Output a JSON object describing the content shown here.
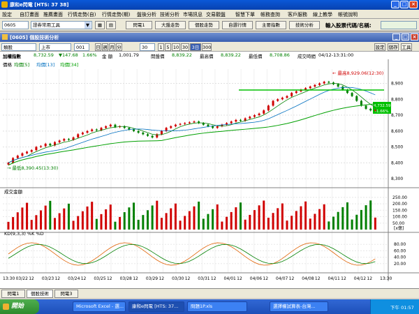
{
  "titlebar": {
    "title": "康和e閃電 [HTS: 37 38]"
  },
  "menu": [
    "設定",
    "自訂畫面",
    "推薦畫面",
    "行情走勢(自)",
    "行情走勢(期)",
    "盤後分析",
    "技術分析",
    "市場訊息",
    "交易觀盤",
    "智慧下單",
    "帳務查詢",
    "客戶服務",
    "線上教學",
    "帳號說明"
  ],
  "toolbar": {
    "stock_code": "0605",
    "dropdown": "證券常用工具",
    "buttons": [
      "閃電1",
      "大盤走勢",
      "個股走勢",
      "自選行情",
      "主要指數",
      "技術分析"
    ],
    "search_label": "輸入股票代碼/名稱:",
    "search_value": ""
  },
  "window": {
    "title": "[0605] 個股技術分析"
  },
  "controls": {
    "type": "類股",
    "market": "上市",
    "code": "001",
    "periods": [
      "日",
      "週",
      "月",
      "分"
    ],
    "count": "30",
    "minutes": [
      "1",
      "5",
      "10",
      "30"
    ],
    "selected": "3日(日)",
    "extra": "300",
    "right_buttons": [
      "設定",
      "儲存",
      "工具"
    ]
  },
  "info": {
    "name": "加權指數",
    "price": "8,732.59",
    "change": "▼147.68",
    "pct": "1.66%",
    "volume_label": "金 額",
    "volume": "1,001.79",
    "open_label": "開盤價",
    "open": "8,839.22",
    "high_label": "最高價",
    "high": "8,839.22",
    "low_label": "最低價",
    "low": "8,708.86",
    "time_label": "成交時間",
    "time": "04/12-13:31:00"
  },
  "chart_data": [
    {
      "type": "line",
      "title": "價格",
      "legend": [
        "均價[5]",
        "均價[13]",
        "均價[34]"
      ],
      "yticks": [
        8300,
        8400,
        8500,
        8600,
        8700,
        8800,
        8900
      ],
      "ylim": [
        8270,
        8990
      ],
      "high_annotation": "← 最高8,929.06(12:30)",
      "low_annotation": "→ 最低8,390.45(13:30)",
      "current_price": "8,732.59",
      "current_pct": "-1.66%",
      "closes": [
        8400,
        8430,
        8445,
        8460,
        8470,
        8480,
        8500,
        8505,
        8520,
        8510,
        8530,
        8540,
        8550,
        8545,
        8560,
        8580,
        8590,
        8600,
        8610,
        8605,
        8620,
        8630,
        8640,
        8625,
        8630,
        8620,
        8610,
        8600,
        8590,
        8580,
        8570,
        8560,
        8580,
        8600,
        8620,
        8630,
        8640,
        8645,
        8650,
        8655,
        8660,
        8650,
        8640,
        8630,
        8620,
        8630,
        8640,
        8650,
        8660,
        8670,
        8665,
        8680,
        8690,
        8700,
        8710,
        8730,
        8760,
        8790,
        8800,
        8810,
        8820,
        8840,
        8850,
        8860,
        8870,
        8880,
        8890,
        8900,
        8910,
        8905,
        8895,
        8880,
        8860,
        8840,
        8820,
        8790,
        8760,
        8740,
        8730,
        8732
      ]
    },
    {
      "type": "bar",
      "title": "成交金額",
      "yticks": [
        50,
        100,
        150,
        200,
        250
      ],
      "ylim": [
        0,
        260
      ],
      "unit": "[x億]"
    },
    {
      "type": "line",
      "title": "KD(9,3,3) %K %D",
      "yticks": [
        20,
        40,
        60,
        80
      ],
      "ylim": [
        0,
        100
      ]
    }
  ],
  "xaxis": [
    "13:30",
    "03/22",
    "12",
    "03/23",
    "12",
    "03/24",
    "12",
    "03/25",
    "12",
    "03/28",
    "12",
    "03/29",
    "12",
    "03/30",
    "12",
    "03/31",
    "12",
    "04/01",
    "12",
    "04/06",
    "12",
    "04/07",
    "12",
    "04/08",
    "12",
    "04/11",
    "12",
    "04/12",
    "12",
    "13:30"
  ],
  "bottom_tabs": [
    "閃電1",
    "個股技術",
    "閃電3"
  ],
  "taskbar": {
    "start": "開始",
    "items": [
      "Microsoft Excel - 選...",
      "康和e閃電 [HTS: 37...",
      "問題1P.xls",
      "選擇權試算表-台灣..."
    ],
    "clock": "下午 01:57"
  }
}
